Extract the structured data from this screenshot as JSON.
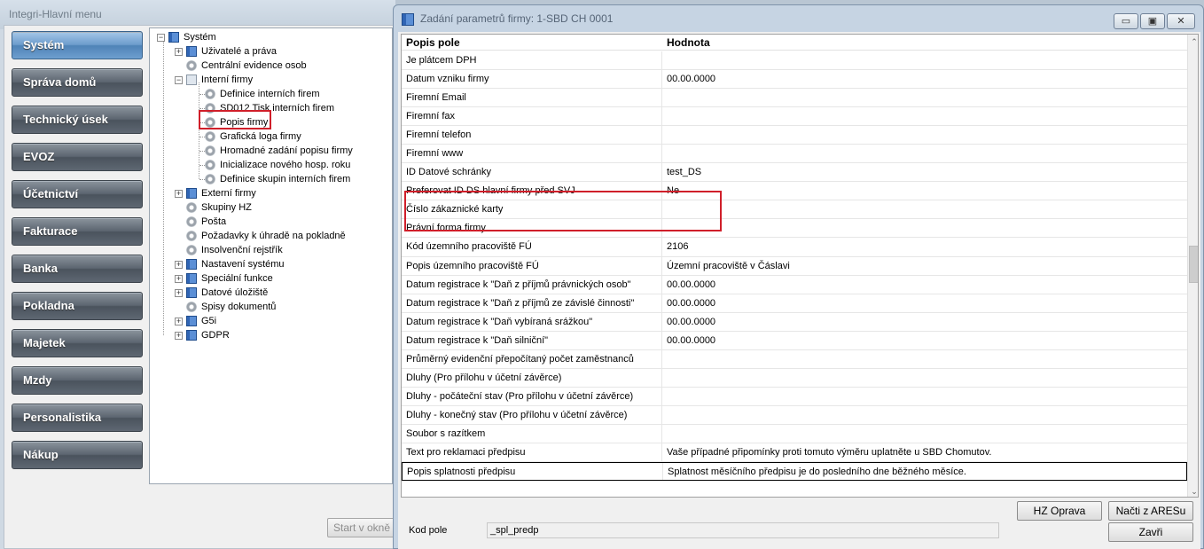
{
  "main_window": {
    "title": "Integri-Hlavní menu",
    "nav_buttons": [
      "Systém",
      "Správa domů",
      "Technický úsek",
      "EVOZ",
      "Účetnictví",
      "Fakturace",
      "Banka",
      "Pokladna",
      "Majetek",
      "Mzdy",
      "Personalistika",
      "Nákup"
    ],
    "active_nav": "Systém",
    "start_button": "Start v okně",
    "tree": {
      "root": "Systém",
      "items": [
        {
          "label": "Uživatelé a práva",
          "icon": "book-icon"
        },
        {
          "label": "Centrální evidence osob",
          "icon": "gear-icon"
        },
        {
          "label": "Interní firmy",
          "icon": "open-book-icon"
        },
        {
          "label": "Definice interních firem",
          "icon": "gear-icon"
        },
        {
          "label": "SD012 Tisk interních firem",
          "icon": "gear-icon"
        },
        {
          "label": "Popis firmy",
          "icon": "gear-icon"
        },
        {
          "label": "Grafická loga firmy",
          "icon": "gear-icon"
        },
        {
          "label": "Hromadné zadání popisu firmy",
          "icon": "gear-icon"
        },
        {
          "label": "Inicializace nového hosp. roku",
          "icon": "gear-icon"
        },
        {
          "label": "Definice skupin interních firem",
          "icon": "gear-icon"
        },
        {
          "label": "Externí firmy",
          "icon": "book-icon"
        },
        {
          "label": "Skupiny HZ",
          "icon": "gear-icon"
        },
        {
          "label": "Pošta",
          "icon": "gear-icon"
        },
        {
          "label": "Požadavky k úhradě na pokladně",
          "icon": "gear-icon"
        },
        {
          "label": "Insolvenční rejstřík",
          "icon": "gear-icon"
        },
        {
          "label": "Nastavení systému",
          "icon": "book-icon"
        },
        {
          "label": "Speciální funkce",
          "icon": "book-icon"
        },
        {
          "label": "Datové úložiště",
          "icon": "book-icon"
        },
        {
          "label": "Spisy dokumentů",
          "icon": "gear-icon"
        },
        {
          "label": "G5i",
          "icon": "book-icon"
        },
        {
          "label": "GDPR",
          "icon": "book-icon"
        }
      ]
    }
  },
  "dialog": {
    "title": "Zadání parametrů firmy: 1-SBD CH 0001",
    "window_buttons": {
      "minimize": "▭",
      "maximize": "▣",
      "close": "✕"
    },
    "columns": {
      "field": "Popis pole",
      "value": "Hodnota"
    },
    "rows": [
      {
        "field": "Je plátcem DPH",
        "value": ""
      },
      {
        "field": "Datum vzniku firmy",
        "value": "00.00.0000"
      },
      {
        "field": "Firemní Email",
        "value": ""
      },
      {
        "field": "Firemní fax",
        "value": ""
      },
      {
        "field": "Firemní telefon",
        "value": ""
      },
      {
        "field": "Firemní www",
        "value": ""
      },
      {
        "field": "ID Datové schránky",
        "value": "test_DS"
      },
      {
        "field": "Preferovat ID DS hlavní firmy před SVJ",
        "value": "Ne"
      },
      {
        "field": "Číslo zákaznické karty",
        "value": ""
      },
      {
        "field": "Právní forma firmy",
        "value": ""
      },
      {
        "field": "Kód územního pracoviště FÚ",
        "value": "2106"
      },
      {
        "field": "Popis územního pracoviště FÚ",
        "value": "Územní pracoviště v Čáslavi"
      },
      {
        "field": "Datum registrace k \"Daň z příjmů právnických osob\"",
        "value": "00.00.0000"
      },
      {
        "field": "Datum registrace k \"Daň z příjmů ze závislé činnosti\"",
        "value": "00.00.0000"
      },
      {
        "field": "Datum registrace k \"Daň vybíraná srážkou\"",
        "value": "00.00.0000"
      },
      {
        "field": "Datum registrace k \"Daň silniční\"",
        "value": "00.00.0000"
      },
      {
        "field": "Průměrný evidenční přepočítaný počet zaměstnanců",
        "value": ""
      },
      {
        "field": "Dluhy (Pro přílohu v účetní závěrce)",
        "value": ""
      },
      {
        "field": "Dluhy - počáteční stav (Pro přílohu v účetní závěrce)",
        "value": ""
      },
      {
        "field": "Dluhy - konečný stav (Pro přílohu v účetní závěrce)",
        "value": ""
      },
      {
        "field": "Soubor s razítkem",
        "value": ""
      },
      {
        "field": "Text pro reklamaci předpisu",
        "value": "Vaše případné připomínky proti tomuto výměru uplatněte u SBD Chomutov."
      },
      {
        "field": "Popis splatnosti předpisu",
        "value": "Splatnost měsíčního předpisu je do posledního dne běžného měsíce."
      }
    ],
    "selected_row": 22,
    "kod_pole_label": "Kod pole",
    "kod_pole_value": "_spl_predp",
    "buttons": {
      "hz_oprava": "HZ Oprava",
      "nacti_z_aresu": "Načti z ARESu",
      "zavri": "Zavři"
    }
  },
  "colors": {
    "highlight": "#d01f2a",
    "nav_active": "#4f83b7",
    "nav": "#4a535d"
  }
}
